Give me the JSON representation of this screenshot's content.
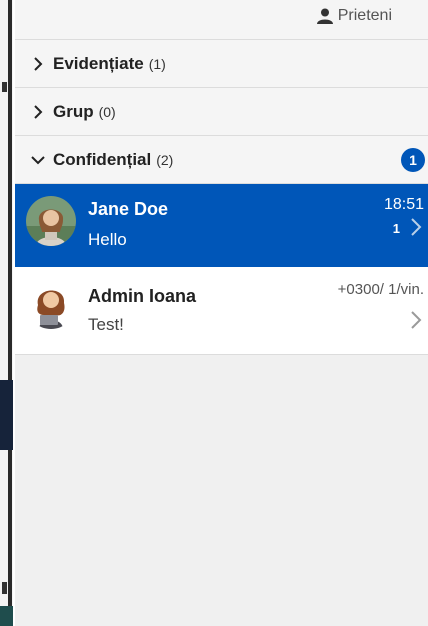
{
  "header": {
    "friends_label": "Prieteni",
    "friends_icon": "person-icon"
  },
  "groups": [
    {
      "name": "Evidențiate",
      "count": "(1)",
      "expanded": false
    },
    {
      "name": "Grup",
      "count": "(0)",
      "expanded": false
    },
    {
      "name": "Confidențial",
      "count": "(2)",
      "expanded": true,
      "badge": "1"
    }
  ],
  "chats": [
    {
      "name": "Jane Doe",
      "message": "Hello",
      "time": "18:51",
      "unread": "1",
      "selected": true
    },
    {
      "name": "Admin Ioana",
      "message": "Test!",
      "time": "+0300/ 1/vin.",
      "unread": "",
      "selected": false
    }
  ],
  "colors": {
    "accent": "#0056b8",
    "panel_bg": "#f0f0f0",
    "row_bg": "#f5f5f5"
  }
}
